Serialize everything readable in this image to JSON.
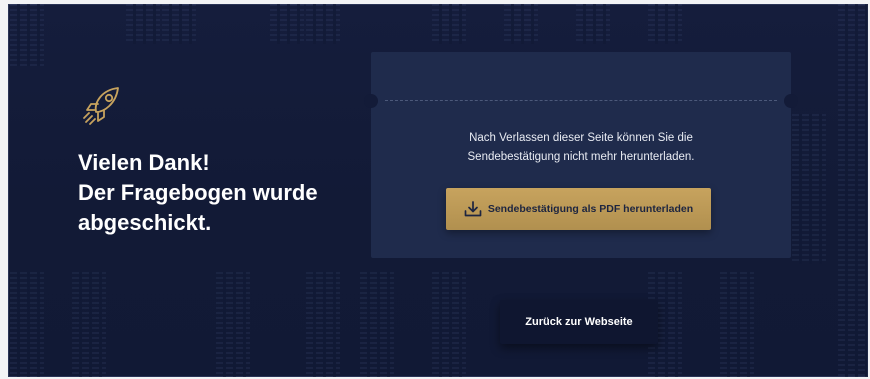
{
  "page": {
    "headline_line1": "Vielen Dank!",
    "headline_line2": "Der Fragebogen wurde",
    "headline_line3": "abgeschickt.",
    "rocket_icon": "rocket-icon"
  },
  "ticket": {
    "notice_line1": "Nach Verlassen dieser Seite können Sie die",
    "notice_line2": "Sendebestätigung nicht mehr herunterladen.",
    "download_button_label": "Sendebestätigung als PDF herunterladen",
    "download_icon": "download-icon"
  },
  "footer": {
    "back_button_label": "Zurück zur Webseite"
  },
  "colors": {
    "background": "#131b38",
    "ticket": "#1f2b4c",
    "accent_gold": "#c7a35e",
    "text": "#ffffff"
  }
}
